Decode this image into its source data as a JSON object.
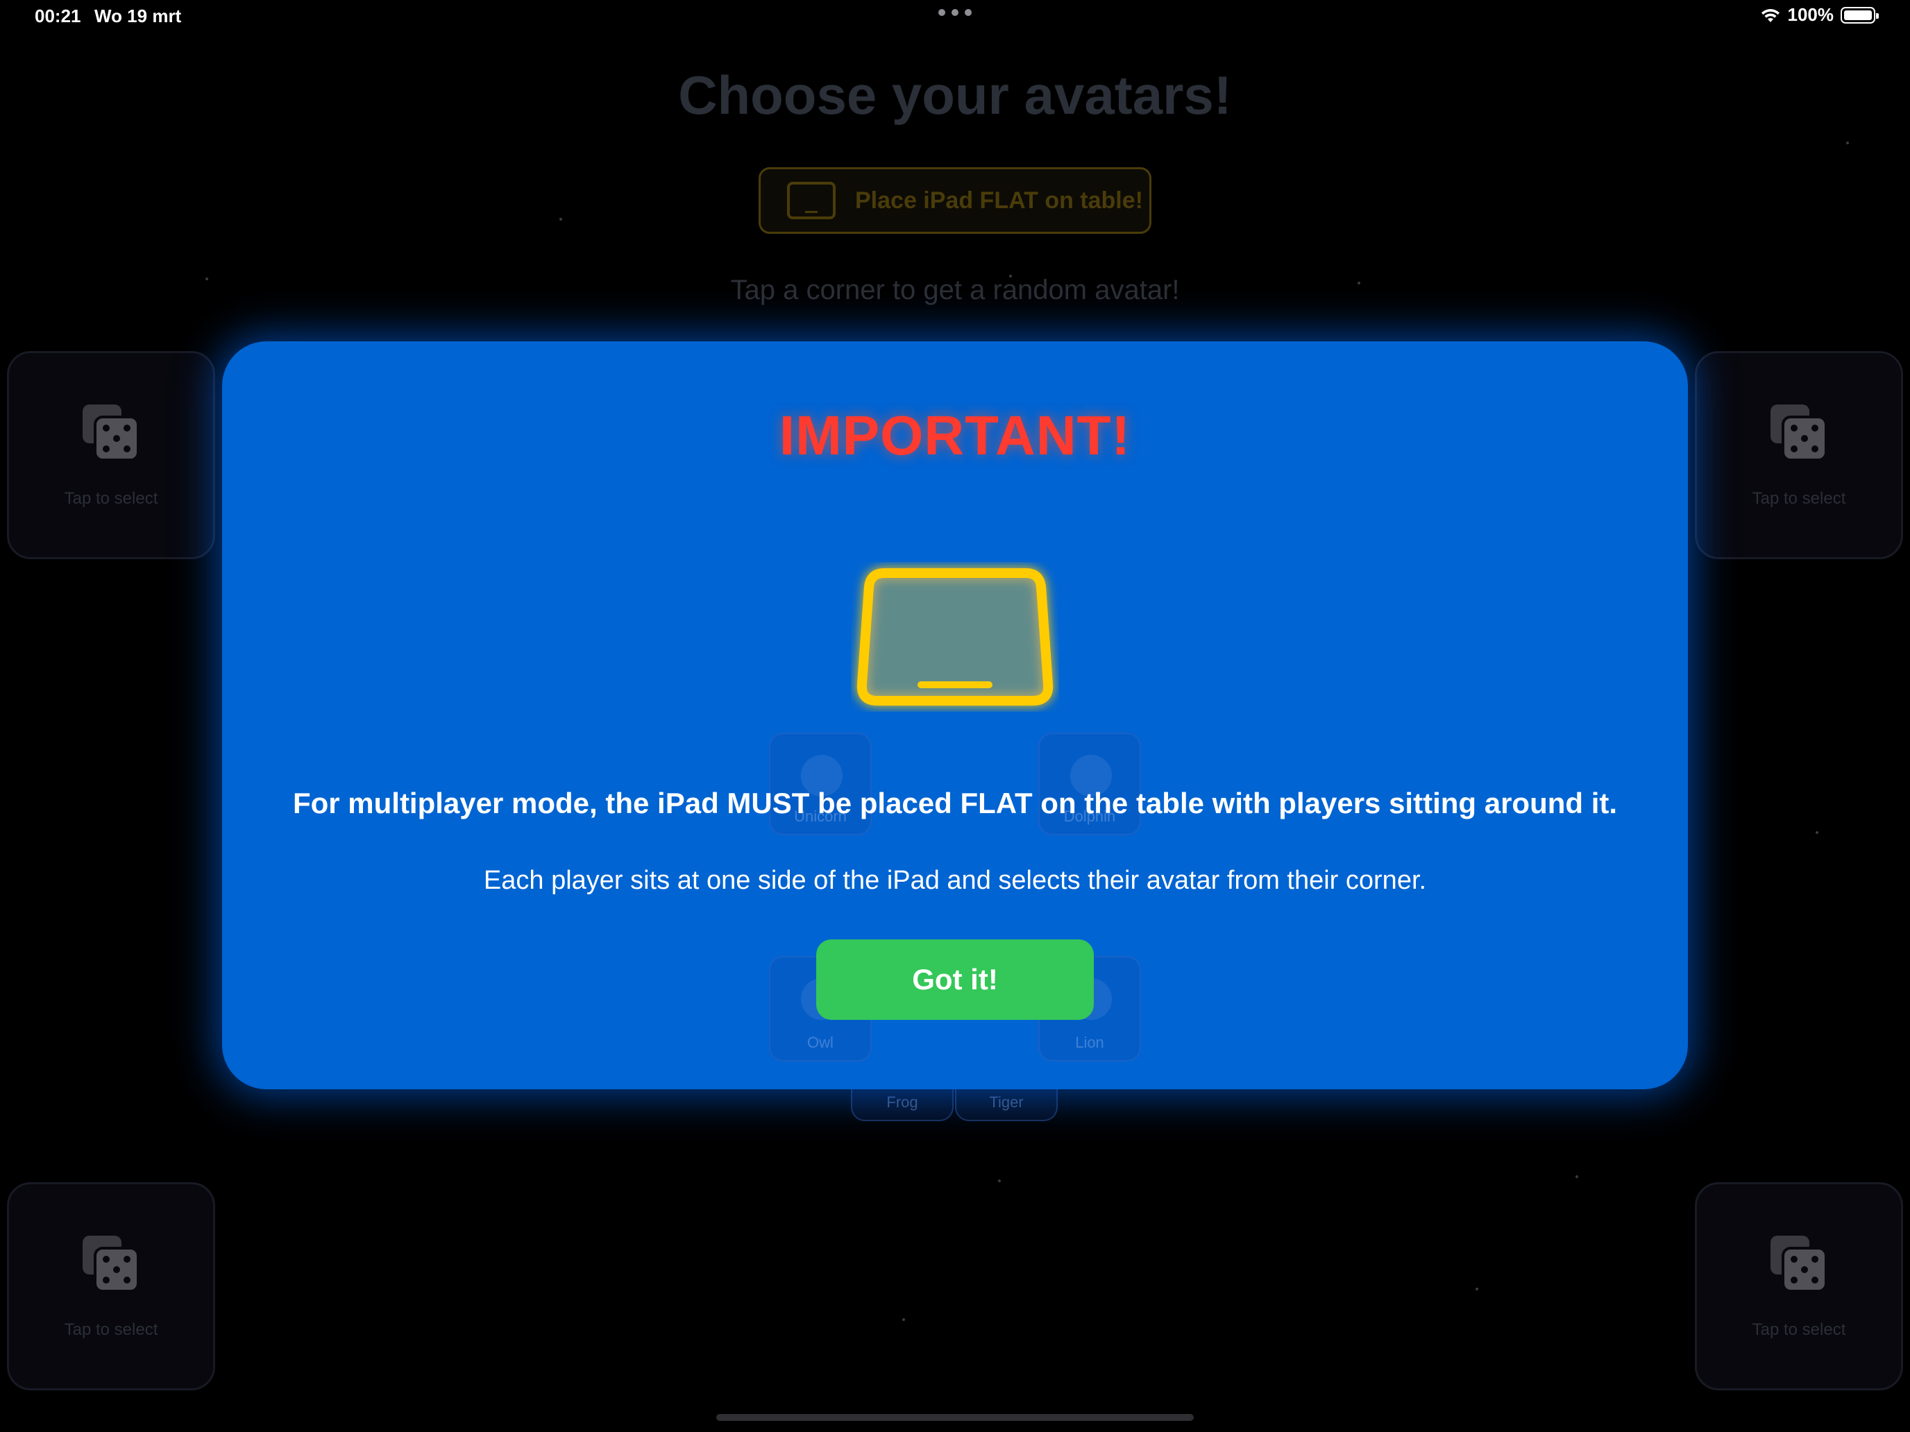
{
  "status_bar": {
    "time": "00:21",
    "date": "Wo 19 mrt",
    "battery": "100%",
    "wifi_icon": "wifi-icon",
    "battery_icon": "battery-full-icon"
  },
  "background": {
    "title": "Choose your avatars!",
    "flat_button_label": "Place iPad FLAT on table!",
    "subtitle": "Tap a corner to get a random avatar!",
    "corners": [
      {
        "label": "Tap to select",
        "icon": "dice-icon"
      },
      {
        "label": "Tap to select",
        "icon": "dice-icon"
      },
      {
        "label": "Tap to select",
        "icon": "dice-icon"
      },
      {
        "label": "Tap to select",
        "icon": "dice-icon"
      }
    ],
    "avatars": [
      "Unicorn",
      "Dolphin",
      "Owl",
      "Lion",
      "Frog",
      "Tiger"
    ]
  },
  "modal": {
    "title": "IMPORTANT!",
    "icon": "ipad-flat-icon",
    "heading": "For multiplayer mode, the iPad MUST be placed FLAT on the table with players sitting around it.",
    "body": "Each player sits at one side of the iPad and selects their avatar from their corner.",
    "button_label": "Got it!"
  },
  "colors": {
    "modal_background": "#0064d2",
    "title_red": "#ff3b30",
    "icon_yellow": "#ffcc00",
    "button_green": "#34c759"
  }
}
